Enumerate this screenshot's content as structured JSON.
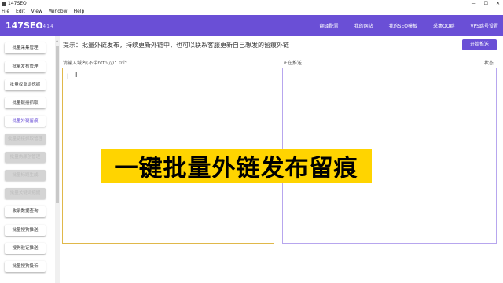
{
  "window": {
    "title": "147SEO",
    "controls": [
      "—",
      "☐",
      "✕"
    ]
  },
  "menu": [
    "File",
    "Edit",
    "View",
    "Window",
    "Help"
  ],
  "header": {
    "logo": "147SEO",
    "version": "v1.4.1.4",
    "nav": [
      "翻译配置",
      "我的网站",
      "我的SEO模板",
      "采集QQ群",
      "VPS跳号设置"
    ],
    "accent_color": "#6a4fd6"
  },
  "sidebar": {
    "items": [
      {
        "label": "批量采集管理",
        "state": "normal"
      },
      {
        "label": "批量发布管理",
        "state": "normal"
      },
      {
        "label": "批量权重词挖掘",
        "state": "normal"
      },
      {
        "label": "批量链接抓取",
        "state": "normal"
      },
      {
        "label": "批量外链留痕",
        "state": "active"
      },
      {
        "label": "批量链接抓取管理",
        "state": "disabled"
      },
      {
        "label": "批量伪原创管理",
        "state": "disabled"
      },
      {
        "label": "批量标题生成",
        "state": "disabled"
      },
      {
        "label": "批量关键词挖掘",
        "state": "disabled"
      },
      {
        "label": "收录数据查询",
        "state": "normal"
      },
      {
        "label": "批量搜狗推送",
        "state": "normal"
      },
      {
        "label": "搜狗验证推送",
        "state": "normal"
      },
      {
        "label": "批量搜狗投诉",
        "state": "normal"
      }
    ]
  },
  "main": {
    "hint": "提示：批量外链发布，持续更新外链中，也可以联系客服更新自己想发的留痕外链",
    "start_button": "开始推送",
    "input_label": "请输入域名(不带http://)：0个",
    "pushing_label": "正在推送",
    "status_label": "状态",
    "input_value": "|"
  },
  "overlay": {
    "banner": "一键批量外链发布留痕",
    "color": "#ffd400"
  }
}
